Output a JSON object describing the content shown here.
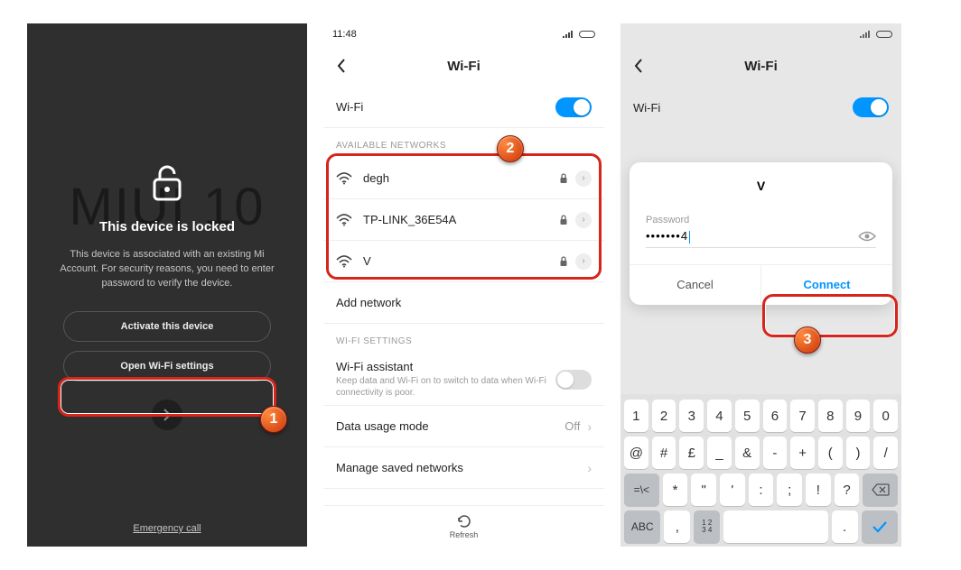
{
  "phone1": {
    "bg_text": "MIUI 10",
    "title": "This device is locked",
    "description": "This device is associated with an existing Mi Account. For security reasons, you need to enter password to verify the device.",
    "activate_btn": "Activate this device",
    "wifi_btn": "Open Wi-Fi settings",
    "emergency": "Emergency call"
  },
  "phone2": {
    "time": "11:48",
    "header": "Wi-Fi",
    "wifi_row": "Wi-Fi",
    "section_available": "AVAILABLE NETWORKS",
    "networks": [
      {
        "name": "degh"
      },
      {
        "name": "TP-LINK_36E54A"
      },
      {
        "name": "V"
      }
    ],
    "add_network": "Add network",
    "section_settings": "WI-FI SETTINGS",
    "assistant_title": "Wi-Fi assistant",
    "assistant_sub": "Keep data and Wi-Fi on to switch to data when Wi-Fi connectivity is poor.",
    "data_usage": "Data usage mode",
    "data_usage_value": "Off",
    "manage_saved": "Manage saved networks",
    "refresh": "Refresh"
  },
  "phone3": {
    "header": "Wi-Fi",
    "wifi_row": "Wi-Fi",
    "dialog_title": "V",
    "pwd_label": "Password",
    "pwd_value": "•••••••4",
    "cancel": "Cancel",
    "connect": "Connect",
    "keyboard": {
      "row1": [
        "1",
        "2",
        "3",
        "4",
        "5",
        "6",
        "7",
        "8",
        "9",
        "0"
      ],
      "row2": [
        "@",
        "#",
        "£",
        "_",
        "&",
        "-",
        "+",
        "(",
        ")",
        "/"
      ],
      "row3_shift": "=\\<",
      "row3": [
        "*",
        "\"",
        "'",
        ":",
        ";",
        "!",
        "?"
      ],
      "row3_back": "⌫",
      "row4_abc": "ABC",
      "row4_comma": ",",
      "row4_numfrac": "1234",
      "row4_dot": ".",
      "row4_enter": "✓"
    }
  },
  "badges": {
    "b1": "1",
    "b2": "2",
    "b3": "3"
  }
}
